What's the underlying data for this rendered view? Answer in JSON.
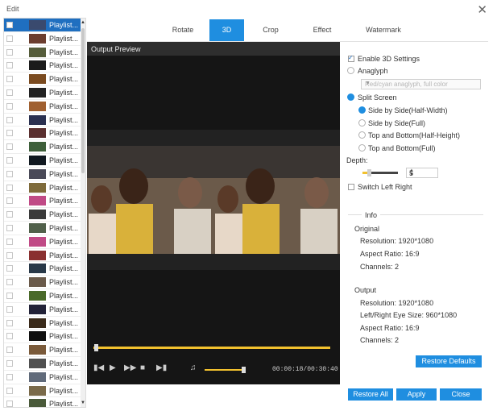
{
  "window": {
    "title": "Edit",
    "close_glyph": "✕"
  },
  "playlist": {
    "items": [
      {
        "label": "Playlist...",
        "color": "#3a4a6e"
      },
      {
        "label": "Playlist...",
        "color": "#6b3d2e"
      },
      {
        "label": "Playlist...",
        "color": "#555c3a"
      },
      {
        "label": "Playlist...",
        "color": "#1b1b1b"
      },
      {
        "label": "Playlist...",
        "color": "#7a4a1f"
      },
      {
        "label": "Playlist...",
        "color": "#222222"
      },
      {
        "label": "Playlist...",
        "color": "#a06030"
      },
      {
        "label": "Playlist...",
        "color": "#2a3050"
      },
      {
        "label": "Playlist...",
        "color": "#5a2f2f"
      },
      {
        "label": "Playlist...",
        "color": "#3e5f3a"
      },
      {
        "label": "Playlist...",
        "color": "#101820"
      },
      {
        "label": "Playlist...",
        "color": "#4a4a58"
      },
      {
        "label": "Playlist...",
        "color": "#7e6a3a"
      },
      {
        "label": "Playlist...",
        "color": "#c04a86"
      },
      {
        "label": "Playlist...",
        "color": "#3a3a3a"
      },
      {
        "label": "Playlist...",
        "color": "#50604a"
      },
      {
        "label": "Playlist...",
        "color": "#c04a86"
      },
      {
        "label": "Playlist...",
        "color": "#8a3030"
      },
      {
        "label": "Playlist...",
        "color": "#283848"
      },
      {
        "label": "Playlist...",
        "color": "#6a5a4a"
      },
      {
        "label": "Playlist...",
        "color": "#4a6a2a"
      },
      {
        "label": "Playlist...",
        "color": "#222238"
      },
      {
        "label": "Playlist...",
        "color": "#3a2a1a"
      },
      {
        "label": "Playlist...",
        "color": "#101010"
      },
      {
        "label": "Playlist...",
        "color": "#7a5a3a"
      },
      {
        "label": "Playlist...",
        "color": "#505050"
      },
      {
        "label": "Playlist...",
        "color": "#606a7a"
      },
      {
        "label": "Playlist...",
        "color": "#7a6a4a"
      },
      {
        "label": "Playlist...",
        "color": "#4a5a3a"
      }
    ],
    "selected_index": 0
  },
  "tabs": [
    "Rotate",
    "3D",
    "Crop",
    "Effect",
    "Watermark"
  ],
  "active_tab": "3D",
  "preview": {
    "header": "Output Preview",
    "time": "00:00:18/00:30:40",
    "seek_fraction": 0.01,
    "volume_fraction": 0.95
  },
  "settings": {
    "enable_3d": {
      "label": "Enable 3D Settings",
      "checked": true
    },
    "anaglyph": {
      "label": "Anaglyph",
      "selected": false
    },
    "anaglyph_select": "Red/cyan anaglyph, full color",
    "split_screen": {
      "label": "Split Screen",
      "selected": true
    },
    "split_options": [
      {
        "label": "Side by Side(Half-Width)",
        "selected": true
      },
      {
        "label": "Side by Side(Full)",
        "selected": false
      },
      {
        "label": "Top and Bottom(Half-Height)",
        "selected": false
      },
      {
        "label": "Top and Bottom(Full)",
        "selected": false
      }
    ],
    "depth_label": "Depth:",
    "depth_value": "5",
    "switch_lr": {
      "label": "Switch Left Right",
      "checked": false
    }
  },
  "info": {
    "title": "Info",
    "original_title": "Original",
    "original": {
      "resolution": "Resolution: 1920*1080",
      "aspect": "Aspect Ratio: 16:9",
      "channels": "Channels: 2"
    },
    "output_title": "Output",
    "output": {
      "resolution": "Resolution: 1920*1080",
      "eye_size": "Left/Right Eye Size: 960*1080",
      "aspect": "Aspect Ratio: 16:9",
      "channels": "Channels: 2"
    }
  },
  "buttons": {
    "restore_defaults": "Restore Defaults",
    "restore_all": "Restore All",
    "apply": "Apply",
    "close": "Close"
  },
  "accent": "#1f8ee0",
  "player_icons": [
    "skip-back-icon",
    "play-icon",
    "fast-forward-icon",
    "stop-icon",
    "skip-end-icon",
    "volume-icon"
  ]
}
